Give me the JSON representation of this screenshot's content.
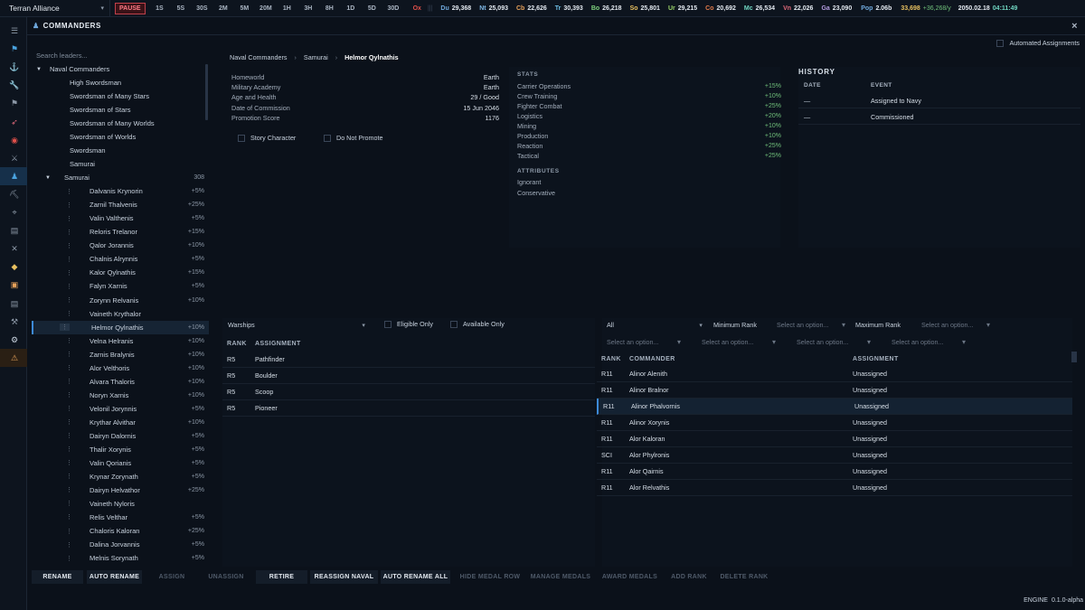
{
  "topbar": {
    "faction": "Terran Alliance",
    "faction_caret": "▾",
    "pause": "PAUSE",
    "speeds": [
      "1S",
      "5S",
      "30S",
      "2M",
      "5M",
      "20M",
      "1H",
      "3H",
      "8H",
      "1D",
      "5D",
      "30D"
    ],
    "ox": "Ox",
    "resources": [
      {
        "code": "Du",
        "value": "29,368",
        "color": "#6fa8dc"
      },
      {
        "code": "Nt",
        "value": "25,093",
        "color": "#7fb8e6"
      },
      {
        "code": "Cb",
        "value": "22,626",
        "color": "#e6a15a"
      },
      {
        "code": "Tr",
        "value": "30,393",
        "color": "#6fc0e8"
      },
      {
        "code": "Bo",
        "value": "26,218",
        "color": "#7dd07d"
      },
      {
        "code": "So",
        "value": "25,801",
        "color": "#e8c060"
      },
      {
        "code": "Ur",
        "value": "29,215",
        "color": "#9bd36a"
      },
      {
        "code": "Co",
        "value": "20,692",
        "color": "#e07a4a"
      },
      {
        "code": "Mc",
        "value": "26,534",
        "color": "#6fd4c0"
      },
      {
        "code": "Vn",
        "value": "22,026",
        "color": "#e06a7a"
      },
      {
        "code": "Ga",
        "value": "23,090",
        "color": "#b39be0"
      }
    ],
    "pop_label": "Pop",
    "pop_value": "2.06b",
    "wealth": "33,698",
    "wealth_rate": "+36,268/y",
    "date": "2050.02.18",
    "time": "04:11:49"
  },
  "panel": {
    "title": "COMMANDERS",
    "close": "×",
    "automated": "Automated Assignments"
  },
  "tree": {
    "search_placeholder": "Search leaders...",
    "root": "Naval Commanders",
    "ranks": [
      "High Swordsman",
      "Swordsman of Many Stars",
      "Swordsman of Stars",
      "Swordsman of Many Worlds",
      "Swordsman of Worlds",
      "Swordsman",
      "Samurai"
    ],
    "group": "Samurai",
    "group_count": "308",
    "members": [
      {
        "name": "Dalvanis Krynorin",
        "val": "+5%"
      },
      {
        "name": "Zarnil Thalvenis",
        "val": "+25%"
      },
      {
        "name": "Valin Valthenis",
        "val": "+5%"
      },
      {
        "name": "Reloris Trelanor",
        "val": "+15%"
      },
      {
        "name": "Qalor Jorannis",
        "val": "+10%"
      },
      {
        "name": "Chalnis Alrynnis",
        "val": "+5%"
      },
      {
        "name": "Kalor Qylnathis",
        "val": "+15%"
      },
      {
        "name": "Falyn Xarnis",
        "val": "+5%"
      },
      {
        "name": "Zorynn Relvanis",
        "val": "+10%"
      },
      {
        "name": "Vaineth Krythalor",
        "val": ""
      },
      {
        "name": "Helmor Qylnathis",
        "val": "+10%"
      },
      {
        "name": "Velna Helranis",
        "val": "+10%"
      },
      {
        "name": "Zarnis Bralynis",
        "val": "+10%"
      },
      {
        "name": "Alor Velthoris",
        "val": "+10%"
      },
      {
        "name": "Alvara Thaloris",
        "val": "+10%"
      },
      {
        "name": "Noryn Xarnis",
        "val": "+10%"
      },
      {
        "name": "Velonil Jorynnis",
        "val": "+5%"
      },
      {
        "name": "Krythar Alvithar",
        "val": "+10%"
      },
      {
        "name": "Dairyn Dalornis",
        "val": "+5%"
      },
      {
        "name": "Thalir Xorynis",
        "val": "+5%"
      },
      {
        "name": "Valin Qorianis",
        "val": "+5%"
      },
      {
        "name": "Krynar Zorynath",
        "val": "+5%"
      },
      {
        "name": "Dairyn Helvathor",
        "val": "+25%"
      },
      {
        "name": "Vaineth Nyloris",
        "val": ""
      },
      {
        "name": "Relis Velthar",
        "val": "+5%"
      },
      {
        "name": "Chaloris Kaloran",
        "val": "+25%"
      },
      {
        "name": "Dalina Jorvannis",
        "val": "+5%"
      },
      {
        "name": "Melnis Sorynath",
        "val": "+5%"
      }
    ]
  },
  "detail": {
    "breadcrumb": [
      "Naval Commanders",
      "Samurai",
      "Helmor Qylnathis"
    ],
    "sep": "›",
    "info": [
      {
        "k": "Homeworld",
        "v": "Earth"
      },
      {
        "k": "Military Academy",
        "v": "Earth"
      },
      {
        "k": "Age and Health",
        "v": "29 / Good"
      },
      {
        "k": "Date of Commission",
        "v": "15 Jun 2046"
      },
      {
        "k": "Promotion Score",
        "v": "1176"
      }
    ],
    "story": "Story Character",
    "nopromote": "Do Not Promote",
    "stats_h": "STATS",
    "stats": [
      {
        "k": "Carrier Operations",
        "v": "+15%"
      },
      {
        "k": "Crew Training",
        "v": "+10%"
      },
      {
        "k": "Fighter Combat",
        "v": "+25%"
      },
      {
        "k": "Logistics",
        "v": "+20%"
      },
      {
        "k": "Mining",
        "v": "+10%"
      },
      {
        "k": "Production",
        "v": "+10%"
      },
      {
        "k": "Reaction",
        "v": "+25%"
      },
      {
        "k": "Tactical",
        "v": "+25%"
      }
    ],
    "attr_h": "ATTRIBUTES",
    "attributes": [
      "Ignorant",
      "Conservative"
    ],
    "history_h": "HISTORY",
    "history_cols": [
      "DATE",
      "EVENT"
    ],
    "history": [
      {
        "date": "—",
        "event": "Assigned to Navy"
      },
      {
        "date": "—",
        "event": "Commissioned"
      }
    ]
  },
  "ships": {
    "filter": "Warships",
    "eligible": "Eligible Only",
    "available": "Available Only",
    "cols": [
      "RANK",
      "ASSIGNMENT"
    ],
    "rows": [
      {
        "rank": "R5",
        "name": "Pathfinder"
      },
      {
        "rank": "R5",
        "name": "Boulder"
      },
      {
        "rank": "R5",
        "name": "Scoop"
      },
      {
        "rank": "R5",
        "name": "Pioneer"
      }
    ]
  },
  "roster": {
    "all": "All",
    "min_rank": "Minimum Rank",
    "max_rank": "Maximum Rank",
    "placeholder": "Select an option...",
    "cols": [
      "RANK",
      "COMMANDER",
      "ASSIGNMENT"
    ],
    "rows": [
      {
        "rank": "R11",
        "name": "Alinor Alenith",
        "assign": "Unassigned"
      },
      {
        "rank": "R11",
        "name": "Alinor Bralnor",
        "assign": "Unassigned"
      },
      {
        "rank": "R11",
        "name": "Alinor Phalvornis",
        "assign": "Unassigned"
      },
      {
        "rank": "R11",
        "name": "Alinor Xorynis",
        "assign": "Unassigned"
      },
      {
        "rank": "R11",
        "name": "Alor Kaloran",
        "assign": "Unassigned"
      },
      {
        "rank": "SCI",
        "name": "Alor Phylronis",
        "assign": "Unassigned"
      },
      {
        "rank": "R11",
        "name": "Alor Qairnis",
        "assign": "Unassigned"
      },
      {
        "rank": "R11",
        "name": "Alor Relvathis",
        "assign": "Unassigned"
      }
    ]
  },
  "buttons": [
    {
      "label": "RENAME",
      "on": true
    },
    {
      "label": "AUTO RENAME",
      "on": true
    },
    {
      "label": "ASSIGN",
      "on": false
    },
    {
      "label": "UNASSIGN",
      "on": false
    },
    {
      "label": "RETIRE",
      "on": true
    },
    {
      "label": "REASSIGN NAVAL",
      "on": true
    },
    {
      "label": "AUTO RENAME ALL",
      "on": true
    },
    {
      "label": "HIDE MEDAL ROW",
      "on": false
    },
    {
      "label": "MANAGE MEDALS",
      "on": false
    },
    {
      "label": "AWARD MEDALS",
      "on": false
    },
    {
      "label": "ADD RANK",
      "on": false
    },
    {
      "label": "DELETE RANK",
      "on": false
    }
  ],
  "footer": {
    "engine": "ENGINE",
    "version": "0.1.0-alpha"
  },
  "sidebar_icons": [
    "menu-icon",
    "flag-icon",
    "anchor-icon",
    "wrench-icon",
    "pennant-icon",
    "rocket-icon",
    "target-icon",
    "crossed-swords-icon",
    "commander-icon",
    "pickaxe-icon",
    "telescope-icon",
    "clipboard-icon",
    "swords-icon",
    "tag-icon",
    "crate-icon",
    "document-icon",
    "tools-icon",
    "gear-icon",
    "warning-icon"
  ]
}
